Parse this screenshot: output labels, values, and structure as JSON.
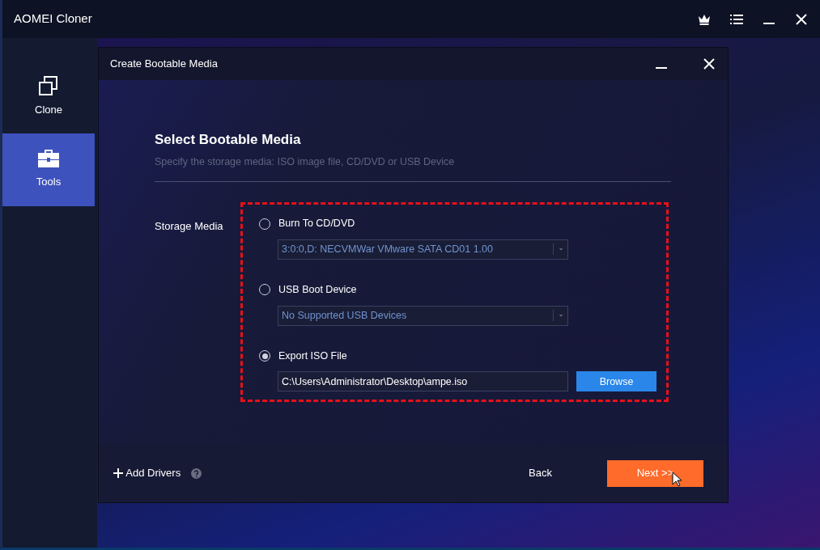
{
  "app": {
    "title": "AOMEI Cloner"
  },
  "sidebar": {
    "items": [
      {
        "label": "Clone",
        "selected": false
      },
      {
        "label": "Tools",
        "selected": true
      }
    ]
  },
  "dialog": {
    "title": "Create Bootable Media",
    "heading": "Select Bootable Media",
    "subtitle": "Specify the storage media: ISO image file, CD/DVD or USB Device",
    "field_label": "Storage Media",
    "options": [
      {
        "kind": "dropdown",
        "label": "Burn To CD/DVD",
        "selected": false,
        "value": "3:0:0,D: NECVMWar VMware SATA CD01 1.00"
      },
      {
        "kind": "dropdown",
        "label": "USB Boot Device",
        "selected": false,
        "value": "No Supported USB Devices"
      },
      {
        "kind": "file",
        "label": "Export ISO File",
        "selected": true,
        "value": "C:\\Users\\Administrator\\Desktop\\ampe.iso",
        "button": "Browse"
      }
    ],
    "add_drivers": "Add Drivers",
    "back": "Back",
    "next": "Next >>"
  }
}
